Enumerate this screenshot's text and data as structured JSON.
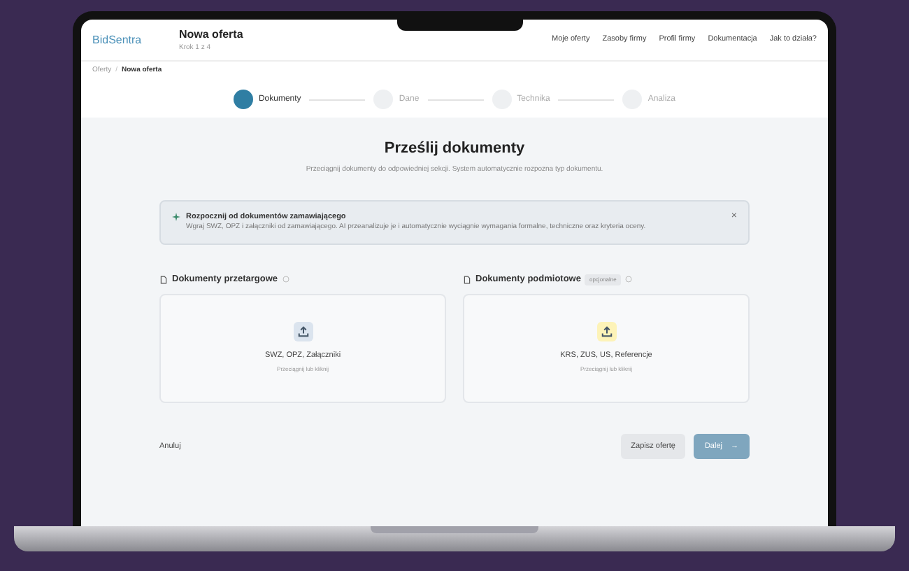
{
  "header": {
    "logo": "BidSentra",
    "title": "Nowa oferta",
    "subtitle": "Krok 1 z 4",
    "nav": [
      {
        "label": "Moje oferty"
      },
      {
        "label": "Zasoby firmy"
      },
      {
        "label": "Profil firmy"
      },
      {
        "label": "Dokumentacja"
      },
      {
        "label": "Jak to działa?"
      }
    ]
  },
  "breadcrumb": [
    "Oferty",
    "Nowa oferta"
  ],
  "breadcrumb_separator": "/",
  "steps": [
    {
      "label": "Dokumenty",
      "selected": true
    },
    {
      "label": "Dane",
      "selected": false
    },
    {
      "label": "Technika",
      "selected": false
    },
    {
      "label": "Analiza",
      "selected": false
    }
  ],
  "heading": "Prześlij dokumenty",
  "description": "Przeciągnij dokumenty do odpowiedniej sekcji. System automatycznie rozpozna typ dokumentu.",
  "alert": {
    "title": "Rozpocznij od dokumentów zamawiającego",
    "body": "Wgraj SWZ, OPZ i załączniki od zamawiającego. AI przeanalizuje je i automatycznie wyciągnie wymagania formalne, techniczne oraz kryteria oceny.",
    "close": "×"
  },
  "sections": [
    {
      "title": "Dokumenty przetargowe",
      "drop_title": "SWZ, OPZ, Załączniki",
      "drop_hint": "Przeciągnij lub kliknij",
      "color": "#dbe4ee"
    },
    {
      "title": "Dokumenty podmiotowe",
      "badge": "opcjonalne",
      "drop_title": "KRS, ZUS, US, Referencje",
      "drop_hint": "Przeciągnij lub kliknij",
      "color": "#fdf3b8"
    }
  ],
  "footer": {
    "cancel": "Anuluj",
    "save": "Zapisz ofertę",
    "next": "Dalej",
    "next_arrow": "→"
  }
}
